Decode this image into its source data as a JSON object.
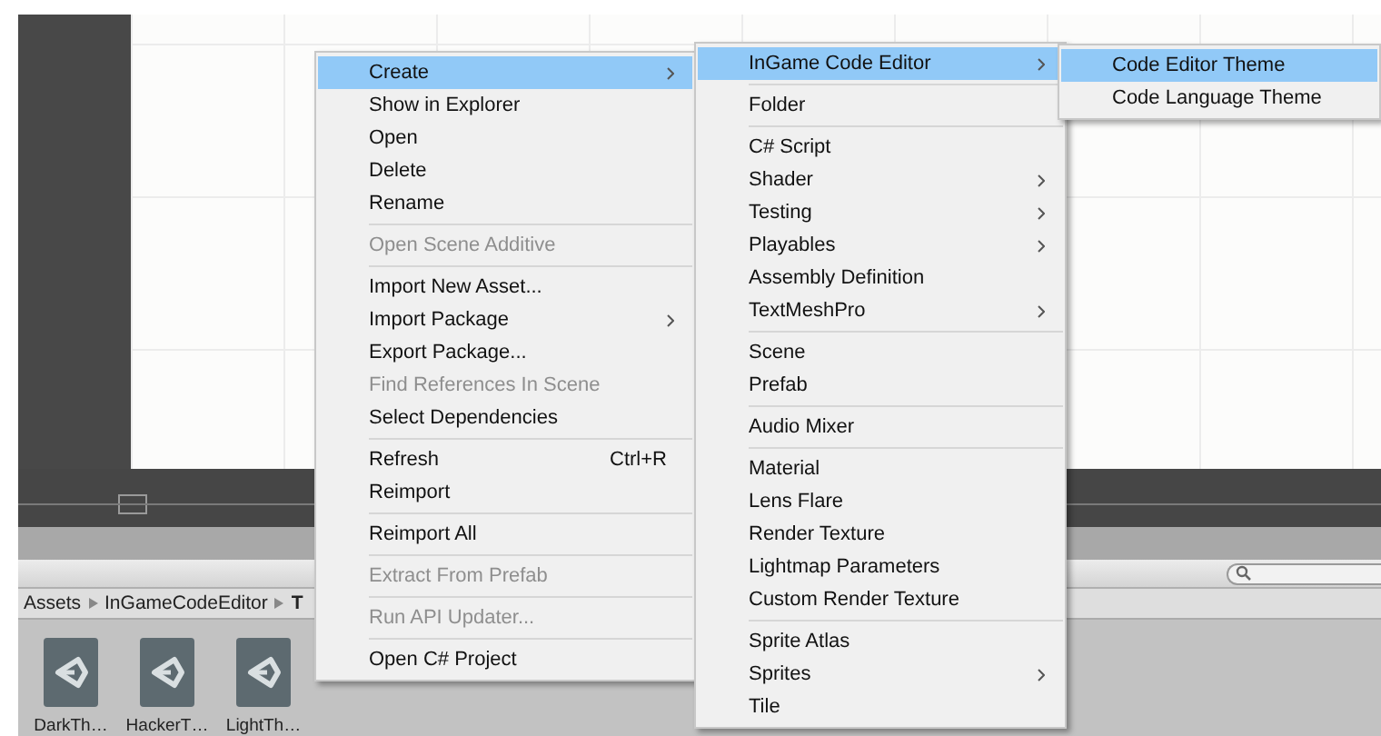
{
  "project": {
    "breadcrumb": [
      "Assets",
      "InGameCodeEditor",
      "T"
    ],
    "assets": [
      {
        "name": "DarkTh…"
      },
      {
        "name": "HackerT…"
      },
      {
        "name": "LightTh…"
      }
    ]
  },
  "menus": [
    {
      "items": [
        {
          "kind": "item",
          "label": "Create",
          "selected": true,
          "disabled": false,
          "submenu": true
        },
        {
          "kind": "item",
          "label": "Show in Explorer",
          "selected": false,
          "disabled": false,
          "submenu": false
        },
        {
          "kind": "item",
          "label": "Open",
          "selected": false,
          "disabled": false,
          "submenu": false
        },
        {
          "kind": "item",
          "label": "Delete",
          "selected": false,
          "disabled": false,
          "submenu": false
        },
        {
          "kind": "item",
          "label": "Rename",
          "selected": false,
          "disabled": false,
          "submenu": false
        },
        {
          "kind": "separator"
        },
        {
          "kind": "item",
          "label": "Open Scene Additive",
          "selected": false,
          "disabled": true,
          "submenu": false
        },
        {
          "kind": "separator"
        },
        {
          "kind": "item",
          "label": "Import New Asset...",
          "selected": false,
          "disabled": false,
          "submenu": false
        },
        {
          "kind": "item",
          "label": "Import Package",
          "selected": false,
          "disabled": false,
          "submenu": true
        },
        {
          "kind": "item",
          "label": "Export Package...",
          "selected": false,
          "disabled": false,
          "submenu": false
        },
        {
          "kind": "item",
          "label": "Find References In Scene",
          "selected": false,
          "disabled": true,
          "submenu": false
        },
        {
          "kind": "item",
          "label": "Select Dependencies",
          "selected": false,
          "disabled": false,
          "submenu": false
        },
        {
          "kind": "separator"
        },
        {
          "kind": "item",
          "label": "Refresh",
          "shortcut": "Ctrl+R",
          "selected": false,
          "disabled": false,
          "submenu": false
        },
        {
          "kind": "item",
          "label": "Reimport",
          "selected": false,
          "disabled": false,
          "submenu": false
        },
        {
          "kind": "separator"
        },
        {
          "kind": "item",
          "label": "Reimport All",
          "selected": false,
          "disabled": false,
          "submenu": false
        },
        {
          "kind": "separator"
        },
        {
          "kind": "item",
          "label": "Extract From Prefab",
          "selected": false,
          "disabled": true,
          "submenu": false
        },
        {
          "kind": "separator"
        },
        {
          "kind": "item",
          "label": "Run API Updater...",
          "selected": false,
          "disabled": true,
          "submenu": false
        },
        {
          "kind": "separator"
        },
        {
          "kind": "item",
          "label": "Open C# Project",
          "selected": false,
          "disabled": false,
          "submenu": false
        }
      ]
    },
    {
      "items": [
        {
          "kind": "item",
          "label": "InGame Code Editor",
          "selected": true,
          "disabled": false,
          "submenu": true
        },
        {
          "kind": "separator"
        },
        {
          "kind": "item",
          "label": "Folder",
          "selected": false,
          "disabled": false,
          "submenu": false
        },
        {
          "kind": "separator"
        },
        {
          "kind": "item",
          "label": "C# Script",
          "selected": false,
          "disabled": false,
          "submenu": false
        },
        {
          "kind": "item",
          "label": "Shader",
          "selected": false,
          "disabled": false,
          "submenu": true
        },
        {
          "kind": "item",
          "label": "Testing",
          "selected": false,
          "disabled": false,
          "submenu": true
        },
        {
          "kind": "item",
          "label": "Playables",
          "selected": false,
          "disabled": false,
          "submenu": true
        },
        {
          "kind": "item",
          "label": "Assembly Definition",
          "selected": false,
          "disabled": false,
          "submenu": false
        },
        {
          "kind": "item",
          "label": "TextMeshPro",
          "selected": false,
          "disabled": false,
          "submenu": true
        },
        {
          "kind": "separator"
        },
        {
          "kind": "item",
          "label": "Scene",
          "selected": false,
          "disabled": false,
          "submenu": false
        },
        {
          "kind": "item",
          "label": "Prefab",
          "selected": false,
          "disabled": false,
          "submenu": false
        },
        {
          "kind": "separator"
        },
        {
          "kind": "item",
          "label": "Audio Mixer",
          "selected": false,
          "disabled": false,
          "submenu": false
        },
        {
          "kind": "separator"
        },
        {
          "kind": "item",
          "label": "Material",
          "selected": false,
          "disabled": false,
          "submenu": false
        },
        {
          "kind": "item",
          "label": "Lens Flare",
          "selected": false,
          "disabled": false,
          "submenu": false
        },
        {
          "kind": "item",
          "label": "Render Texture",
          "selected": false,
          "disabled": false,
          "submenu": false
        },
        {
          "kind": "item",
          "label": "Lightmap Parameters",
          "selected": false,
          "disabled": false,
          "submenu": false
        },
        {
          "kind": "item",
          "label": "Custom Render Texture",
          "selected": false,
          "disabled": false,
          "submenu": false
        },
        {
          "kind": "separator"
        },
        {
          "kind": "item",
          "label": "Sprite Atlas",
          "selected": false,
          "disabled": false,
          "submenu": false
        },
        {
          "kind": "item",
          "label": "Sprites",
          "selected": false,
          "disabled": false,
          "submenu": true
        },
        {
          "kind": "item",
          "label": "Tile",
          "selected": false,
          "disabled": false,
          "submenu": false
        }
      ]
    },
    {
      "items": [
        {
          "kind": "item",
          "label": "Code Editor Theme",
          "selected": true,
          "disabled": false,
          "submenu": false
        },
        {
          "kind": "item",
          "label": "Code Language Theme",
          "selected": false,
          "disabled": false,
          "submenu": false
        }
      ]
    }
  ]
}
